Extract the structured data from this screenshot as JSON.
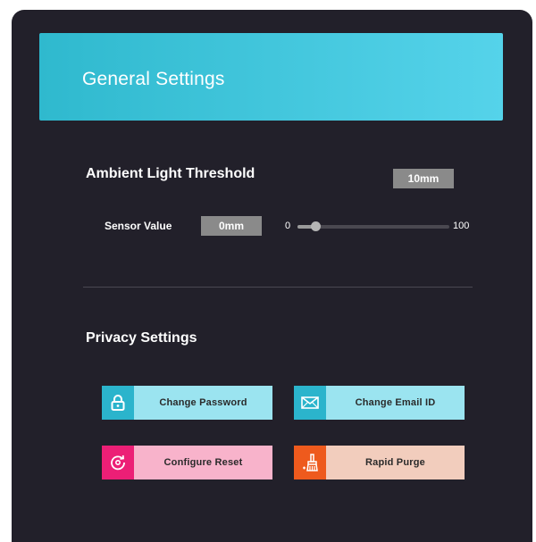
{
  "header": {
    "title": "General Settings"
  },
  "ambient": {
    "title": "Ambient Light Threshold",
    "threshold_value": "10mm",
    "sensor_label": "Sensor Value",
    "sensor_value": "0mm",
    "slider": {
      "min_label": "0",
      "max_label": "100",
      "value": 12,
      "min": 0,
      "max": 100
    }
  },
  "privacy": {
    "title": "Privacy Settings",
    "buttons": [
      {
        "label": "Change Password",
        "icon": "lock-icon",
        "icon_color": "#2bb4cc",
        "label_bg": "#9be4f0"
      },
      {
        "label": "Change Email ID",
        "icon": "envelope-icon",
        "icon_color": "#2bb4cc",
        "label_bg": "#9be4f0"
      },
      {
        "label": "Configure Reset",
        "icon": "reset-icon",
        "icon_color": "#ec1f76",
        "label_bg": "#f8b3cb"
      },
      {
        "label": "Rapid Purge",
        "icon": "broom-icon",
        "icon_color": "#ee5a1d",
        "label_bg": "#f2cdbd"
      }
    ]
  },
  "colors": {
    "panel_bg": "#22202a",
    "header_gradient_start": "#2fb9ce",
    "header_gradient_end": "#55d3ea",
    "value_box_bg": "#8a8a8a"
  }
}
